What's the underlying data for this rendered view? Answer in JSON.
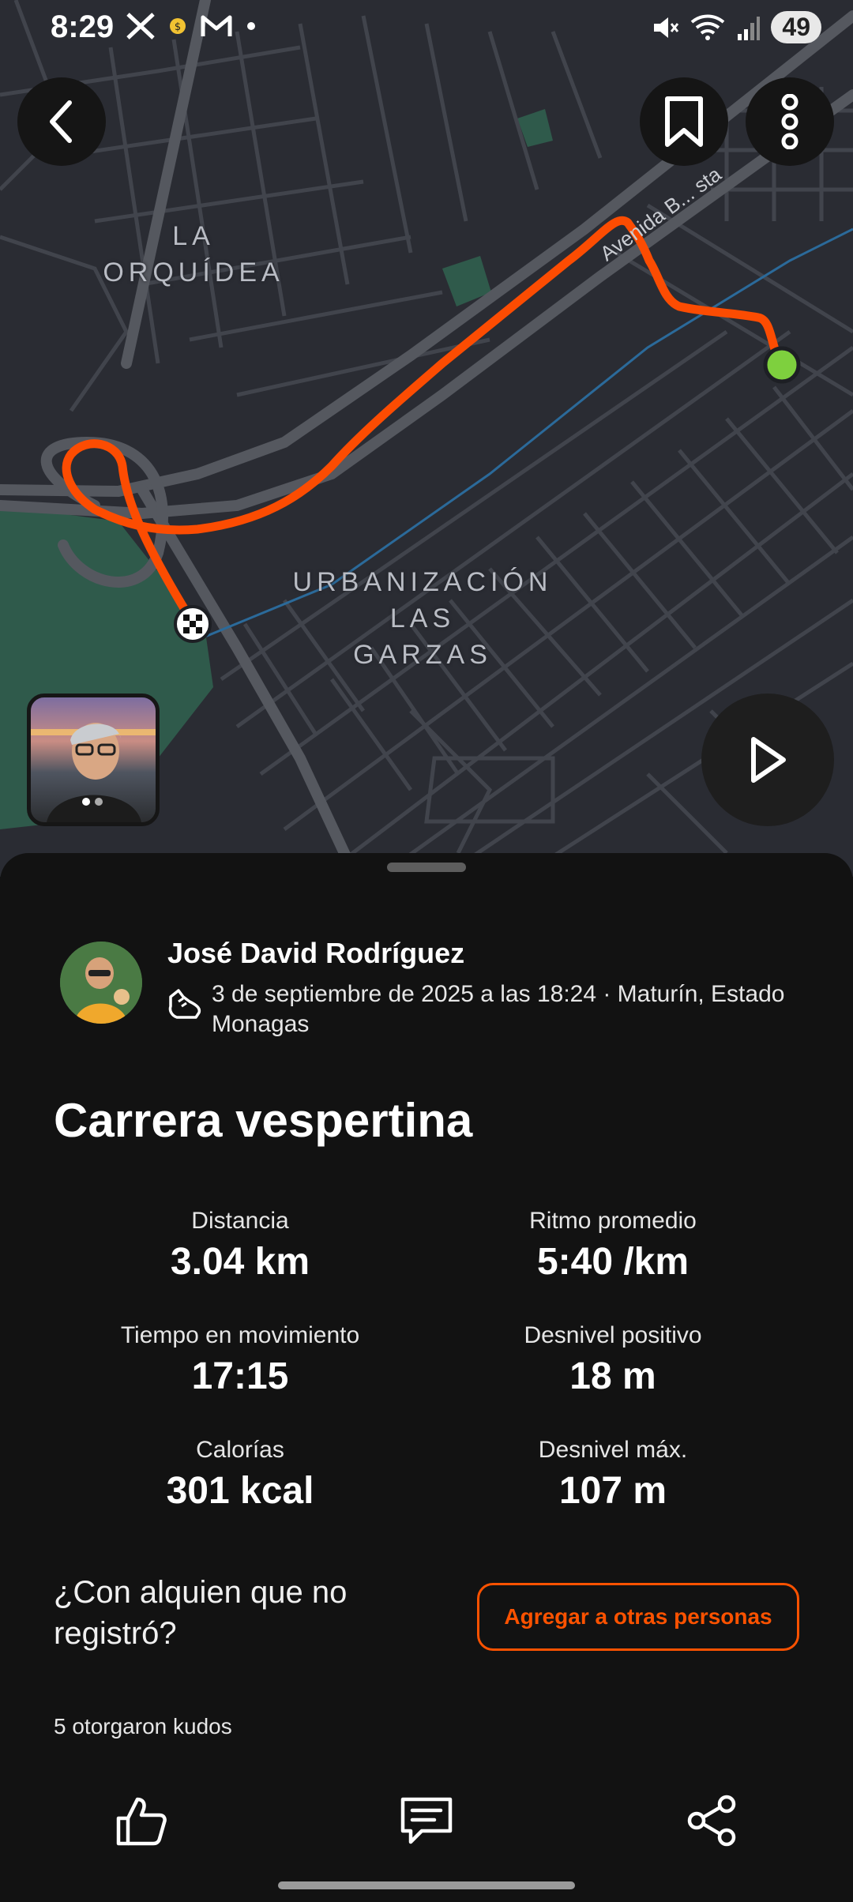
{
  "status_bar": {
    "time": "8:29",
    "battery": "49",
    "left_icons": [
      "x-icon",
      "coin-icon",
      "gmail-icon",
      "dot-icon"
    ],
    "right_icons": [
      "mute-icon",
      "wifi-icon",
      "signal-icon"
    ]
  },
  "map": {
    "labels": {
      "la_orquidea": "LA\nORQUÍDEA",
      "urbanizacion": "URBANIZACIÓN\nLAS\nGARZAS",
      "street": "Avenida B... sta"
    },
    "route_color": "#fc4c02",
    "start_color": "#7ed03e",
    "background": "#2a2c33"
  },
  "header": {
    "back": "back-icon",
    "bookmark": "bookmark-icon",
    "more": "more-vertical-icon"
  },
  "athlete": {
    "name": "José David Rodríguez",
    "meta": "3 de septiembre de 2025 a las 18:24 · Maturín, Estado Monagas"
  },
  "activity": {
    "title": "Carrera vespertina",
    "stats": [
      {
        "label": "Distancia",
        "value": "3.04 km"
      },
      {
        "label": "Ritmo promedio",
        "value": "5:40 /km"
      },
      {
        "label": "Tiempo en movimiento",
        "value": "17:15"
      },
      {
        "label": "Desnivel positivo",
        "value": "18 m"
      },
      {
        "label": "Calorías",
        "value": "301 kcal"
      },
      {
        "label": "Desnivel máx.",
        "value": "107 m"
      }
    ]
  },
  "with_others": {
    "question": "¿Con alquien que no registró?",
    "button": "Agregar a otras personas"
  },
  "kudos": "5 otorgaron kudos",
  "actions": {
    "kudos": "thumbs-up-icon",
    "comment": "comment-icon",
    "share": "share-icon"
  },
  "accent_color": "#fc5200"
}
